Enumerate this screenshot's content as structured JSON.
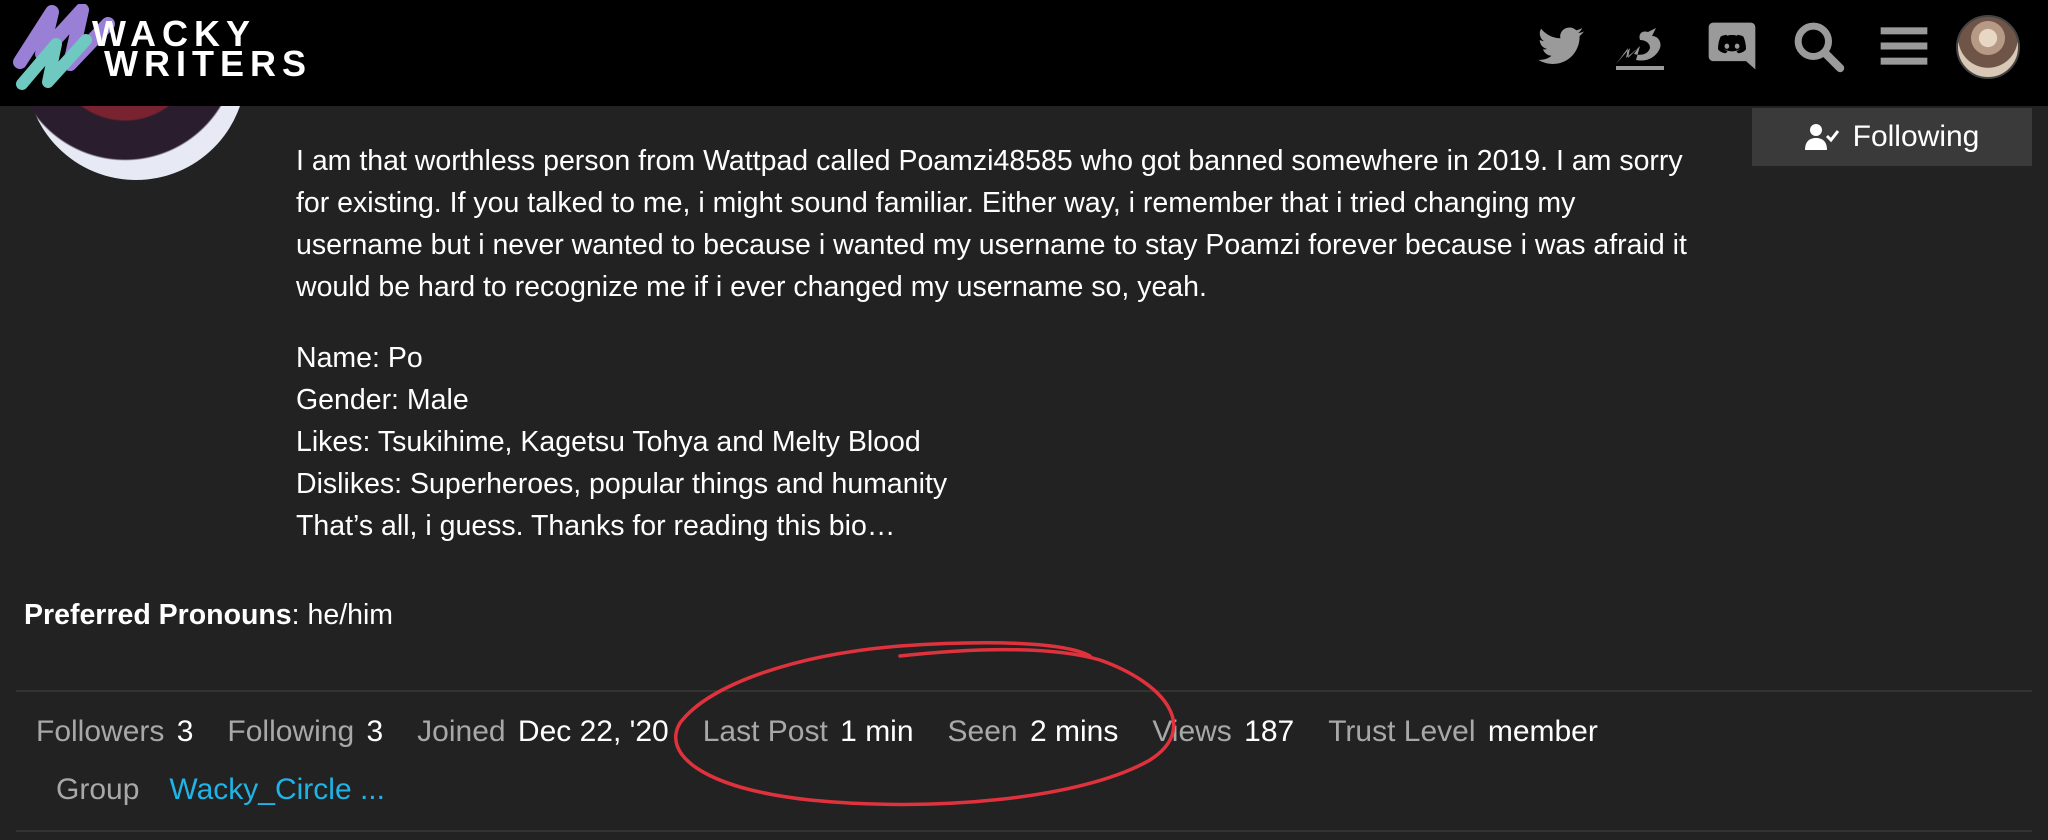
{
  "header": {
    "logo_line1": "WACKY",
    "logo_line2": "WRITERS",
    "icons": [
      "twitter-icon",
      "dragon-icon",
      "discord-icon",
      "search-icon",
      "hamburger-menu-icon",
      "user-avatar"
    ]
  },
  "profile": {
    "follow_button_label": "Following",
    "bio_paragraph": "I am that worthless person from Wattpad called Poamzi48585 who got banned somewhere in 2019. I am sorry for existing. If you talked to me, i might sound familiar. Either way, i remember that i tried changing my username but i never wanted to because i wanted my username to stay Poamzi forever because i was afraid it would be hard to recognize me if i ever changed my username so, yeah.",
    "bio_lines": [
      "Name: Po",
      "Gender: Male",
      "Likes: Tsukihime, Kagetsu Tohya and Melty Blood",
      "Dislikes: Superheroes, popular things and humanity",
      "That’s all, i guess. Thanks for reading this bio…"
    ],
    "pronouns_label": "Preferred Pronouns",
    "pronouns_value": ": he/him"
  },
  "stats": {
    "followers_label": "Followers",
    "followers_value": "3",
    "following_label": "Following",
    "following_value": "3",
    "joined_label": "Joined",
    "joined_value": "Dec 22, '20",
    "last_post_label": "Last Post",
    "last_post_value": "1 min",
    "seen_label": "Seen",
    "seen_value": "2 mins",
    "views_label": "Views",
    "views_value": "187",
    "trust_label": "Trust Level",
    "trust_value": "member",
    "group_label": "Group",
    "group_value": "Wacky_Circle ..."
  },
  "colors": {
    "background": "#222222",
    "header": "#000000",
    "link": "#1fb3e6",
    "annotation": "#e0323c"
  }
}
